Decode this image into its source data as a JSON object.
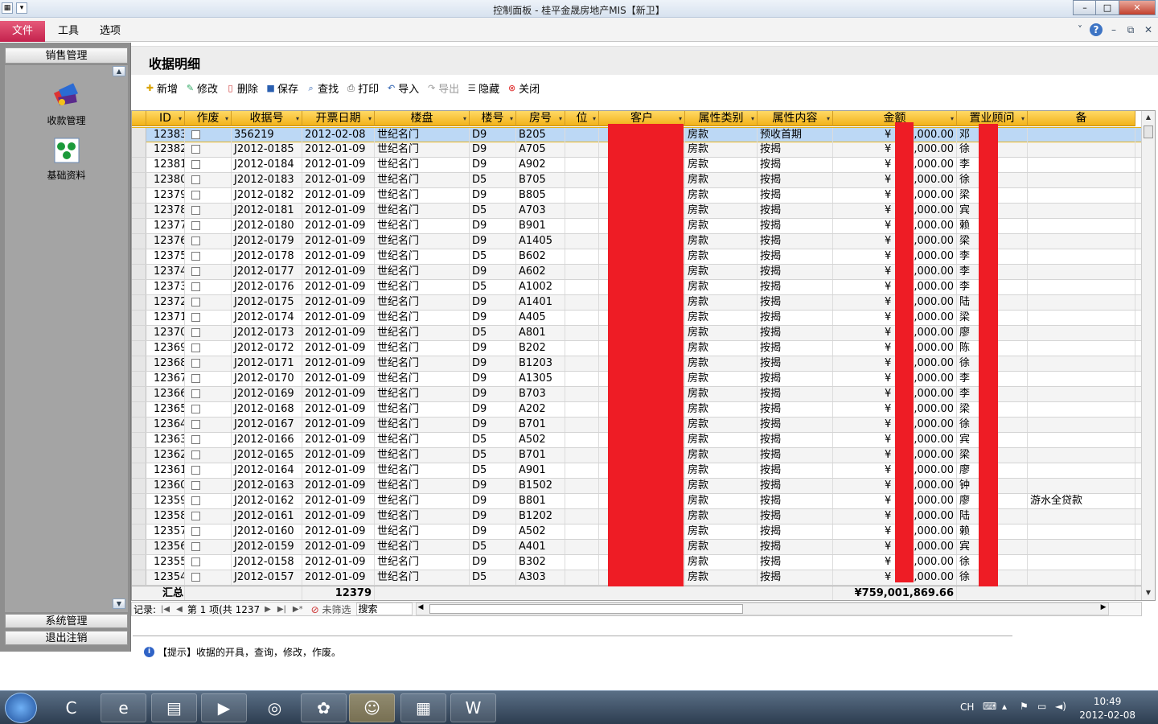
{
  "window": {
    "title": "控制面板 - 桂平金晟房地产MIS【新卫】"
  },
  "menu": {
    "file": "文件",
    "tools": "工具",
    "options": "选项"
  },
  "sidebar": {
    "header": "销售管理",
    "items": [
      {
        "label": "收款管理",
        "icon": "cash-management-icon"
      },
      {
        "label": "基础资料",
        "icon": "base-data-icon"
      }
    ],
    "bottom": [
      "系统管理",
      "退出注销"
    ]
  },
  "page": {
    "title": "收据明细"
  },
  "toolbar": [
    {
      "label": "新增",
      "icon": "add-icon",
      "disabled": false
    },
    {
      "label": "修改",
      "icon": "edit-icon",
      "disabled": false
    },
    {
      "label": "删除",
      "icon": "delete-icon",
      "disabled": false
    },
    {
      "label": "保存",
      "icon": "save-icon",
      "disabled": false
    },
    {
      "label": "查找",
      "icon": "find-icon",
      "disabled": false
    },
    {
      "label": "打印",
      "icon": "print-icon",
      "disabled": false
    },
    {
      "label": "导入",
      "icon": "import-icon",
      "disabled": false
    },
    {
      "label": "导出",
      "icon": "export-icon",
      "disabled": true
    },
    {
      "label": "隐藏",
      "icon": "hide-icon",
      "disabled": false
    },
    {
      "label": "关闭",
      "icon": "close-icon",
      "disabled": false
    }
  ],
  "grid": {
    "columns": [
      "ID",
      "作废",
      "收据号",
      "开票日期",
      "楼盘",
      "楼号",
      "房号",
      "位",
      "客户",
      "属性类别",
      "属性内容",
      "金额",
      "置业顾问",
      "备"
    ],
    "rows": [
      {
        "id": "12383",
        "void": false,
        "receipt": "356219",
        "date": "2012-02-08",
        "estate": "世纪名门",
        "bldg": "D9",
        "room": "B205",
        "pos": "",
        "cat": "房款",
        "content": "预收首期",
        "amt_pre": "¥",
        "amt_suf": ",000.00",
        "adv": "邓",
        "note": ""
      },
      {
        "id": "12382",
        "void": false,
        "receipt": "J2012-0185",
        "date": "2012-01-09",
        "estate": "世纪名门",
        "bldg": "D9",
        "room": "A705",
        "pos": "",
        "cat": "房款",
        "content": "按揭",
        "amt_pre": "¥",
        "amt_suf": ",000.00",
        "adv": "徐",
        "note": ""
      },
      {
        "id": "12381",
        "void": false,
        "receipt": "J2012-0184",
        "date": "2012-01-09",
        "estate": "世纪名门",
        "bldg": "D9",
        "room": "A902",
        "pos": "",
        "cat": "房款",
        "content": "按揭",
        "amt_pre": "¥",
        "amt_suf": ",000.00",
        "adv": "李",
        "note": ""
      },
      {
        "id": "12380",
        "void": false,
        "receipt": "J2012-0183",
        "date": "2012-01-09",
        "estate": "世纪名门",
        "bldg": "D5",
        "room": "B705",
        "pos": "",
        "cat": "房款",
        "content": "按揭",
        "amt_pre": "¥",
        "amt_suf": ",000.00",
        "adv": "徐",
        "note": ""
      },
      {
        "id": "12379",
        "void": false,
        "receipt": "J2012-0182",
        "date": "2012-01-09",
        "estate": "世纪名门",
        "bldg": "D9",
        "room": "B805",
        "pos": "",
        "cat": "房款",
        "content": "按揭",
        "amt_pre": "¥",
        "amt_suf": ",000.00",
        "adv": "梁",
        "note": ""
      },
      {
        "id": "12378",
        "void": false,
        "receipt": "J2012-0181",
        "date": "2012-01-09",
        "estate": "世纪名门",
        "bldg": "D5",
        "room": "A703",
        "pos": "",
        "cat": "房款",
        "content": "按揭",
        "amt_pre": "¥",
        "amt_suf": ",000.00",
        "adv": "宾",
        "note": ""
      },
      {
        "id": "12377",
        "void": false,
        "receipt": "J2012-0180",
        "date": "2012-01-09",
        "estate": "世纪名门",
        "bldg": "D9",
        "room": "B901",
        "pos": "",
        "cat": "房款",
        "content": "按揭",
        "amt_pre": "¥",
        "amt_suf": ",000.00",
        "adv": "赖",
        "note": ""
      },
      {
        "id": "12376",
        "void": false,
        "receipt": "J2012-0179",
        "date": "2012-01-09",
        "estate": "世纪名门",
        "bldg": "D9",
        "room": "A1405",
        "pos": "",
        "cat": "房款",
        "content": "按揭",
        "amt_pre": "¥",
        "amt_suf": ",000.00",
        "adv": "梁",
        "note": ""
      },
      {
        "id": "12375",
        "void": false,
        "receipt": "J2012-0178",
        "date": "2012-01-09",
        "estate": "世纪名门",
        "bldg": "D5",
        "room": "B602",
        "pos": "",
        "cat": "房款",
        "content": "按揭",
        "amt_pre": "¥",
        "amt_suf": ",000.00",
        "adv": "李",
        "note": ""
      },
      {
        "id": "12374",
        "void": false,
        "receipt": "J2012-0177",
        "date": "2012-01-09",
        "estate": "世纪名门",
        "bldg": "D9",
        "room": "A602",
        "pos": "",
        "cat": "房款",
        "content": "按揭",
        "amt_pre": "¥",
        "amt_suf": ",000.00",
        "adv": "李",
        "note": ""
      },
      {
        "id": "12373",
        "void": false,
        "receipt": "J2012-0176",
        "date": "2012-01-09",
        "estate": "世纪名门",
        "bldg": "D5",
        "room": "A1002",
        "pos": "",
        "cat": "房款",
        "content": "按揭",
        "amt_pre": "¥",
        "amt_suf": ",000.00",
        "adv": "李",
        "note": ""
      },
      {
        "id": "12372",
        "void": false,
        "receipt": "J2012-0175",
        "date": "2012-01-09",
        "estate": "世纪名门",
        "bldg": "D9",
        "room": "A1401",
        "pos": "",
        "cat": "房款",
        "content": "按揭",
        "amt_pre": "¥",
        "amt_suf": ",000.00",
        "adv": "陆",
        "note": ""
      },
      {
        "id": "12371",
        "void": false,
        "receipt": "J2012-0174",
        "date": "2012-01-09",
        "estate": "世纪名门",
        "bldg": "D9",
        "room": "A405",
        "pos": "",
        "cat": "房款",
        "content": "按揭",
        "amt_pre": "¥",
        "amt_suf": ",000.00",
        "adv": "梁",
        "note": ""
      },
      {
        "id": "12370",
        "void": false,
        "receipt": "J2012-0173",
        "date": "2012-01-09",
        "estate": "世纪名门",
        "bldg": "D5",
        "room": "A801",
        "pos": "",
        "cat": "房款",
        "content": "按揭",
        "amt_pre": "¥",
        "amt_suf": ",000.00",
        "adv": "廖",
        "note": ""
      },
      {
        "id": "12369",
        "void": false,
        "receipt": "J2012-0172",
        "date": "2012-01-09",
        "estate": "世纪名门",
        "bldg": "D9",
        "room": "B202",
        "pos": "",
        "cat": "房款",
        "content": "按揭",
        "amt_pre": "¥",
        "amt_suf": ",000.00",
        "adv": "陈",
        "note": ""
      },
      {
        "id": "12368",
        "void": false,
        "receipt": "J2012-0171",
        "date": "2012-01-09",
        "estate": "世纪名门",
        "bldg": "D9",
        "room": "B1203",
        "pos": "",
        "cat": "房款",
        "content": "按揭",
        "amt_pre": "¥",
        "amt_suf": ",000.00",
        "adv": "徐",
        "note": ""
      },
      {
        "id": "12367",
        "void": false,
        "receipt": "J2012-0170",
        "date": "2012-01-09",
        "estate": "世纪名门",
        "bldg": "D9",
        "room": "A1305",
        "pos": "",
        "cat": "房款",
        "content": "按揭",
        "amt_pre": "¥",
        "amt_suf": ",000.00",
        "adv": "李",
        "note": ""
      },
      {
        "id": "12366",
        "void": false,
        "receipt": "J2012-0169",
        "date": "2012-01-09",
        "estate": "世纪名门",
        "bldg": "D9",
        "room": "B703",
        "pos": "",
        "cat": "房款",
        "content": "按揭",
        "amt_pre": "¥",
        "amt_suf": ",000.00",
        "adv": "李",
        "note": ""
      },
      {
        "id": "12365",
        "void": false,
        "receipt": "J2012-0168",
        "date": "2012-01-09",
        "estate": "世纪名门",
        "bldg": "D9",
        "room": "A202",
        "pos": "",
        "cat": "房款",
        "content": "按揭",
        "amt_pre": "¥",
        "amt_suf": ",000.00",
        "adv": "梁",
        "note": ""
      },
      {
        "id": "12364",
        "void": false,
        "receipt": "J2012-0167",
        "date": "2012-01-09",
        "estate": "世纪名门",
        "bldg": "D9",
        "room": "B701",
        "pos": "",
        "cat": "房款",
        "content": "按揭",
        "amt_pre": "¥",
        "amt_suf": ",000.00",
        "adv": "徐",
        "note": ""
      },
      {
        "id": "12363",
        "void": false,
        "receipt": "J2012-0166",
        "date": "2012-01-09",
        "estate": "世纪名门",
        "bldg": "D5",
        "room": "A502",
        "pos": "",
        "cat": "房款",
        "content": "按揭",
        "amt_pre": "¥",
        "amt_suf": ",000.00",
        "adv": "宾",
        "note": ""
      },
      {
        "id": "12362",
        "void": false,
        "receipt": "J2012-0165",
        "date": "2012-01-09",
        "estate": "世纪名门",
        "bldg": "D5",
        "room": "B701",
        "pos": "",
        "cat": "房款",
        "content": "按揭",
        "amt_pre": "¥",
        "amt_suf": ",000.00",
        "adv": "梁",
        "note": ""
      },
      {
        "id": "12361",
        "void": false,
        "receipt": "J2012-0164",
        "date": "2012-01-09",
        "estate": "世纪名门",
        "bldg": "D5",
        "room": "A901",
        "pos": "",
        "cat": "房款",
        "content": "按揭",
        "amt_pre": "¥",
        "amt_suf": ",000.00",
        "adv": "廖",
        "note": ""
      },
      {
        "id": "12360",
        "void": false,
        "receipt": "J2012-0163",
        "date": "2012-01-09",
        "estate": "世纪名门",
        "bldg": "D9",
        "room": "B1502",
        "pos": "",
        "cat": "房款",
        "content": "按揭",
        "amt_pre": "¥",
        "amt_suf": ",000.00",
        "adv": "钟",
        "note": ""
      },
      {
        "id": "12359",
        "void": false,
        "receipt": "J2012-0162",
        "date": "2012-01-09",
        "estate": "世纪名门",
        "bldg": "D9",
        "room": "B801",
        "pos": "",
        "cat": "房款",
        "content": "按揭",
        "amt_pre": "¥",
        "amt_suf": ",000.00",
        "adv": "廖",
        "note": "游水全贷款"
      },
      {
        "id": "12358",
        "void": false,
        "receipt": "J2012-0161",
        "date": "2012-01-09",
        "estate": "世纪名门",
        "bldg": "D9",
        "room": "B1202",
        "pos": "",
        "cat": "房款",
        "content": "按揭",
        "amt_pre": "¥",
        "amt_suf": ",000.00",
        "adv": "陆",
        "note": ""
      },
      {
        "id": "12357",
        "void": false,
        "receipt": "J2012-0160",
        "date": "2012-01-09",
        "estate": "世纪名门",
        "bldg": "D9",
        "room": "A502",
        "pos": "",
        "cat": "房款",
        "content": "按揭",
        "amt_pre": "¥",
        "amt_suf": ",000.00",
        "adv": "赖",
        "note": ""
      },
      {
        "id": "12356",
        "void": false,
        "receipt": "J2012-0159",
        "date": "2012-01-09",
        "estate": "世纪名门",
        "bldg": "D5",
        "room": "A401",
        "pos": "",
        "cat": "房款",
        "content": "按揭",
        "amt_pre": "¥",
        "amt_suf": ",000.00",
        "adv": "宾",
        "note": ""
      },
      {
        "id": "12355",
        "void": false,
        "receipt": "J2012-0158",
        "date": "2012-01-09",
        "estate": "世纪名门",
        "bldg": "D9",
        "room": "B302",
        "pos": "",
        "cat": "房款",
        "content": "按揭",
        "amt_pre": "¥",
        "amt_suf": ",000.00",
        "adv": "徐",
        "note": ""
      },
      {
        "id": "12354",
        "void": false,
        "receipt": "J2012-0157",
        "date": "2012-01-09",
        "estate": "世纪名门",
        "bldg": "D5",
        "room": "A303",
        "pos": "",
        "cat": "房款",
        "content": "按揭",
        "amt_pre": "¥",
        "amt_suf": ",000.00",
        "adv": "徐",
        "note": ""
      }
    ],
    "footer": {
      "label": "汇总",
      "receipt_sum": "12379",
      "amount_sum": "¥759,001,869.66"
    },
    "redaction_color": "#ee1c25"
  },
  "navbar": {
    "label": "记录:",
    "position": "第 1 项(共 1237",
    "filter": "未筛选",
    "search": "搜索"
  },
  "hint": {
    "text": "【提示】收据的开具，查询，修改，作废。"
  },
  "taskbar": {
    "ime": "CH",
    "time": "10:49",
    "date": "2012-02-08"
  },
  "colors": {
    "header_gold": "#f2b21a",
    "selected_row": "#bcd8f5",
    "file_tab": "#c4224d"
  }
}
